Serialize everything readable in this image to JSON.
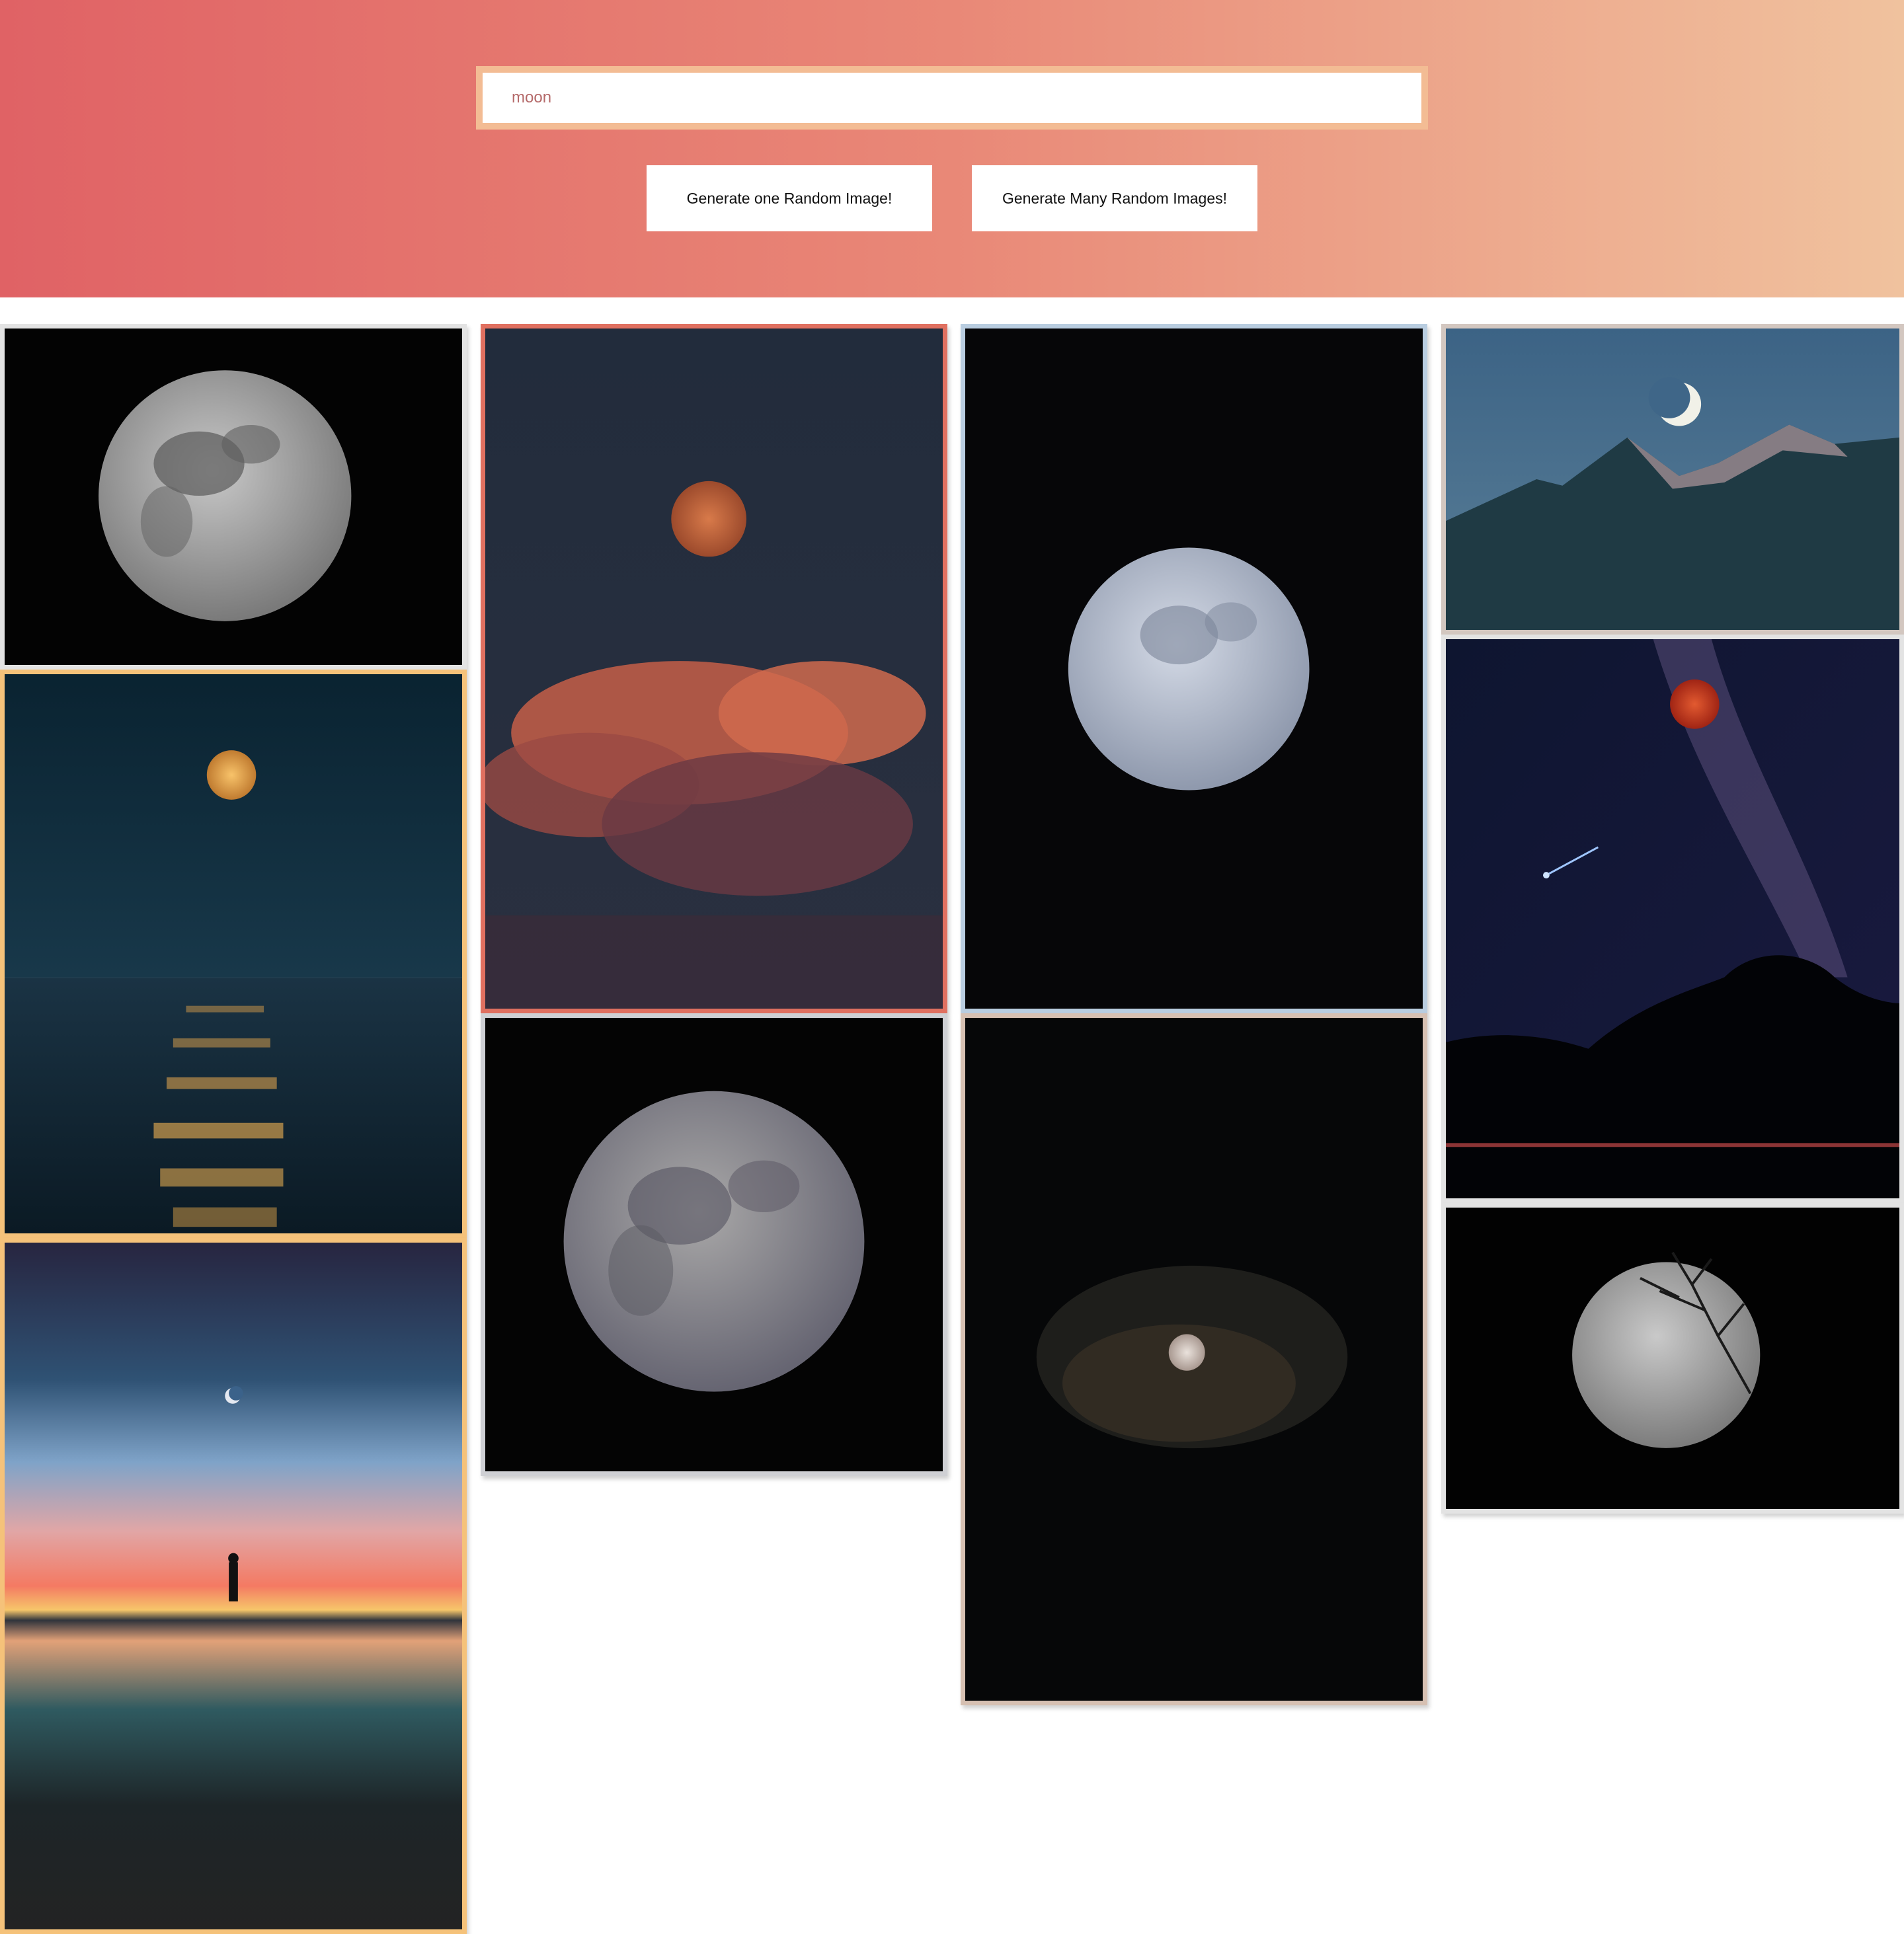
{
  "search": {
    "value": "",
    "placeholder": "moon"
  },
  "buttons": {
    "one_label": "Generate one Random Image!",
    "many_label": "Generate Many Random Images!"
  },
  "gallery": {
    "images": [
      {
        "subject": "full-moon-black-sky",
        "border_color": "#e3e3e3"
      },
      {
        "subject": "moon-over-sea-reflection",
        "border_color": "#f5c27a"
      },
      {
        "subject": "crescent-moon-sunset-silhouette",
        "border_color": "#f5c27a"
      },
      {
        "subject": "red-moon-orange-clouds",
        "border_color": "#e07060"
      },
      {
        "subject": "full-moon-closeup",
        "border_color": "#cfd0d4"
      },
      {
        "subject": "blue-full-moon-black-sky",
        "border_color": "#b9cde0"
      },
      {
        "subject": "small-moon-dark-clouds",
        "border_color": "#d6c0b2"
      },
      {
        "subject": "crescent-moon-over-mountains",
        "border_color": "#d3c7c0"
      },
      {
        "subject": "blood-moon-milky-way",
        "border_color": "#e3e3e3"
      },
      {
        "subject": "full-moon-with-tree-branches",
        "border_color": "#e3e3e3"
      }
    ]
  }
}
